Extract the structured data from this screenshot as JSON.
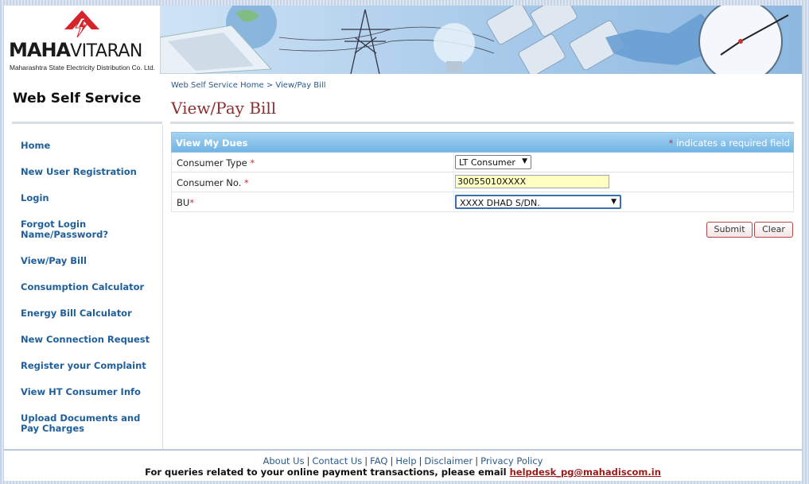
{
  "brand": {
    "name_bold": "MAHA",
    "name_light": "VITARAN",
    "subtitle": "Maharashtra State Electricity Distribution Co. Ltd.",
    "app_title": "Web Self Service"
  },
  "breadcrumb": {
    "home": "Web Self Service Home",
    "separator": ">",
    "current": "View/Pay Bill"
  },
  "page_title": "View/Pay Bill",
  "sidebar": {
    "items": [
      {
        "label": "Home"
      },
      {
        "label": "New User Registration"
      },
      {
        "label": "Login"
      },
      {
        "label": "Forgot Login Name/Password?"
      },
      {
        "label": "View/Pay Bill"
      },
      {
        "label": "Consumption Calculator"
      },
      {
        "label": "Energy Bill Calculator"
      },
      {
        "label": "New Connection Request"
      },
      {
        "label": "Register your Complaint"
      },
      {
        "label": "View HT Consumer Info"
      },
      {
        "label": "Upload Documents and Pay Charges"
      }
    ]
  },
  "form": {
    "title": "View My Dues",
    "required_star": "*",
    "required_note": "indicates a required field",
    "consumer_type": {
      "label": "Consumer Type",
      "star": "*",
      "value": "LT Consumer"
    },
    "consumer_no": {
      "label": "Consumer No.",
      "star": "*",
      "value": "30055010XXXX"
    },
    "bu": {
      "label": "BU",
      "star": "*",
      "value": "XXXX DHAD S/DN."
    },
    "submit_label": "Submit",
    "clear_label": "Clear"
  },
  "footer": {
    "links": [
      "About Us",
      "Contact Us",
      "FAQ",
      "Help",
      "Disclaimer",
      "Privacy Policy"
    ],
    "separator": "|",
    "note": "For queries related to your online payment transactions, please email",
    "email": "helpdesk_pg@mahadiscom.in"
  },
  "colors": {
    "nav_link": "#1f5f9b",
    "page_title": "#8b2f2f",
    "panel_header": "#71b4e4",
    "required_star": "#d42a2a",
    "input_highlight": "#ffffc2"
  },
  "icons": {
    "dropdown": "dropdown-arrow-icon",
    "logo": "mahavitaran-logo-icon"
  }
}
